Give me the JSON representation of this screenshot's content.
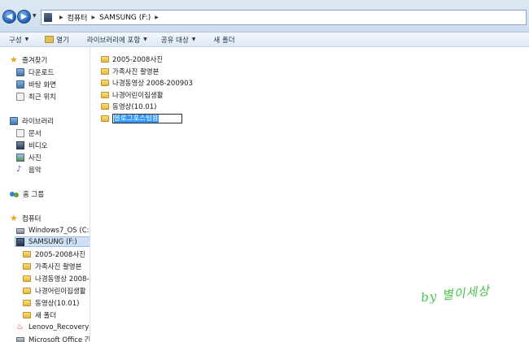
{
  "address": {
    "breadcrumb": [
      "컴퓨터",
      "SAMSUNG (F:)"
    ]
  },
  "toolbar": {
    "organize": "구성",
    "open": "열기",
    "include_library": "라이브러리에 포함",
    "share": "공유 대상",
    "new_folder": "새 폴더"
  },
  "nav": {
    "favorites": "즐겨찾기",
    "downloads": "다운로드",
    "desktop": "바탕 화면",
    "recent": "최근 위치",
    "libraries": "라이브러리",
    "documents": "문서",
    "videos": "비디오",
    "pictures": "사진",
    "music": "음악",
    "homegroup": "홈 그룹",
    "computer": "컴퓨터",
    "drive_c": "Windows7_OS (C:)",
    "drive_f": "SAMSUNG (F:)",
    "sub": [
      "2005-2008사진",
      "가족사진 촬영본",
      "나경동영상 2008-",
      "나경어린이집생활",
      "동영상(10.01)",
      "새 폴더"
    ],
    "recovery": "Lenovo_Recovery (C",
    "office": "Microsoft Office 간"
  },
  "content": {
    "folders": [
      "2005-2008사진",
      "가족사진 촬영본",
      "나경동영상 2008-200903",
      "나경어린이집생활",
      "동영상(10.01)"
    ],
    "rename_value": "블로그포스팅용"
  },
  "watermark": "by 별이세상",
  "colors": {
    "selection": "#cde0f4",
    "watermark": "#4cc04a",
    "rename_highlight": "#3399ff"
  }
}
